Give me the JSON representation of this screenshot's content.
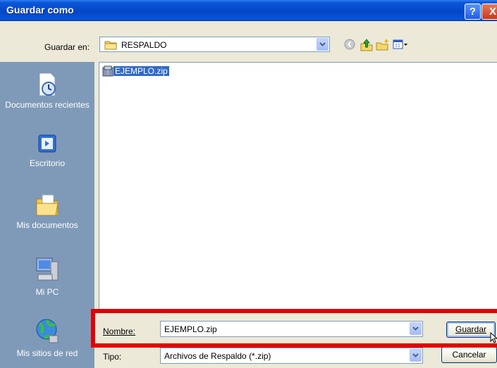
{
  "window": {
    "title": "Guardar como",
    "help_glyph": "?",
    "close_glyph": "X"
  },
  "toolbar": {
    "save_in_label": "Guardar en:",
    "current_folder": "RESPALDO",
    "icons": [
      "back-icon",
      "up-folder-icon",
      "new-folder-icon",
      "views-menu-icon"
    ]
  },
  "places": [
    {
      "label": "Documentos recientes",
      "icon": "recent-documents-icon"
    },
    {
      "label": "Escritorio",
      "icon": "desktop-icon"
    },
    {
      "label": "Mis documentos",
      "icon": "my-documents-icon"
    },
    {
      "label": "Mi PC",
      "icon": "my-computer-icon"
    },
    {
      "label": "Mis sitios de red",
      "icon": "network-places-icon"
    }
  ],
  "files": [
    {
      "name": "EJEMPLO.zip",
      "icon": "zip-file-icon",
      "selected": true
    }
  ],
  "form": {
    "name_label": "Nombre:",
    "name_value": "EJEMPLO.zip",
    "type_label": "Tipo:",
    "type_value": "Archivos de Respaldo (*.zip)"
  },
  "buttons": {
    "save": "Guardar",
    "cancel": "Cancelar"
  },
  "colors": {
    "titlebar": "#0a55d8",
    "places_bar": "#7f9ab8",
    "selection": "#316ac5",
    "highlight_border": "#e30000"
  }
}
